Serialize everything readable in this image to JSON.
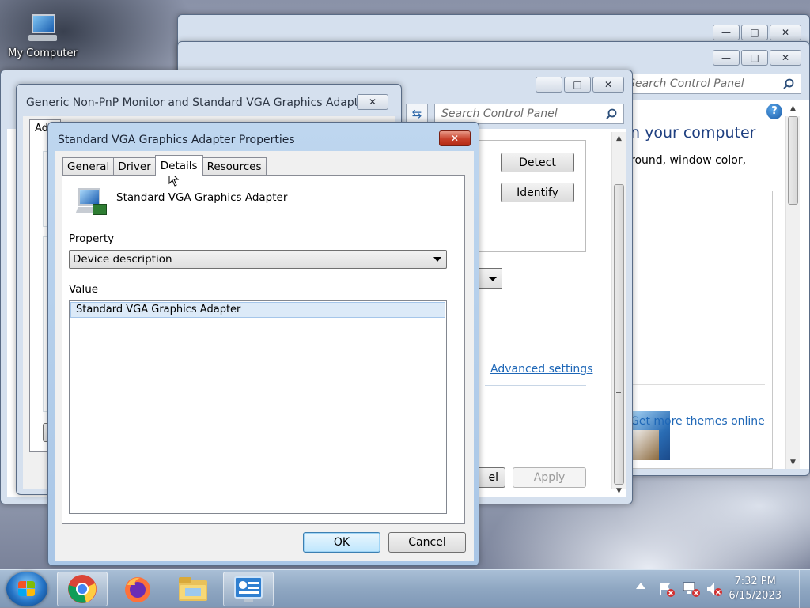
{
  "desktop": {
    "icons": [
      {
        "label": "My Computer"
      }
    ]
  },
  "control_panel_window": {
    "search_placeholder": "Search Control Panel",
    "heading_partial": "n your computer",
    "desc_partial": "round, window color,",
    "more_themes_link": "Get more themes online"
  },
  "display_settings_window": {
    "search_placeholder": "Search Control Panel",
    "detect_label": "Detect",
    "identify_label": "Identify",
    "advanced_settings_link": "Advanced settings",
    "cancel_partial": "el",
    "apply_label": "Apply"
  },
  "monitor_window": {
    "title": "Generic Non-PnP Monitor and Standard VGA Graphics Adapte...",
    "tab_partial": "Ad"
  },
  "properties_dialog": {
    "title": "Standard VGA Graphics Adapter Properties",
    "tabs": [
      {
        "label": "General"
      },
      {
        "label": "Driver"
      },
      {
        "label": "Details"
      },
      {
        "label": "Resources"
      }
    ],
    "active_tab": "Details",
    "device_name": "Standard VGA Graphics Adapter",
    "property_label": "Property",
    "property_value": "Device description",
    "value_label": "Value",
    "values": [
      "Standard VGA Graphics Adapter"
    ],
    "ok_label": "OK",
    "cancel_label": "Cancel"
  },
  "taskbar": {
    "time": "7:32 PM",
    "date": "6/15/2023",
    "apps": [
      "chrome-icon",
      "firefox-icon",
      "file-explorer-icon",
      "control-panel-icon"
    ]
  },
  "colors": {
    "link": "#1e67b7",
    "selection": "#dceaf8"
  }
}
